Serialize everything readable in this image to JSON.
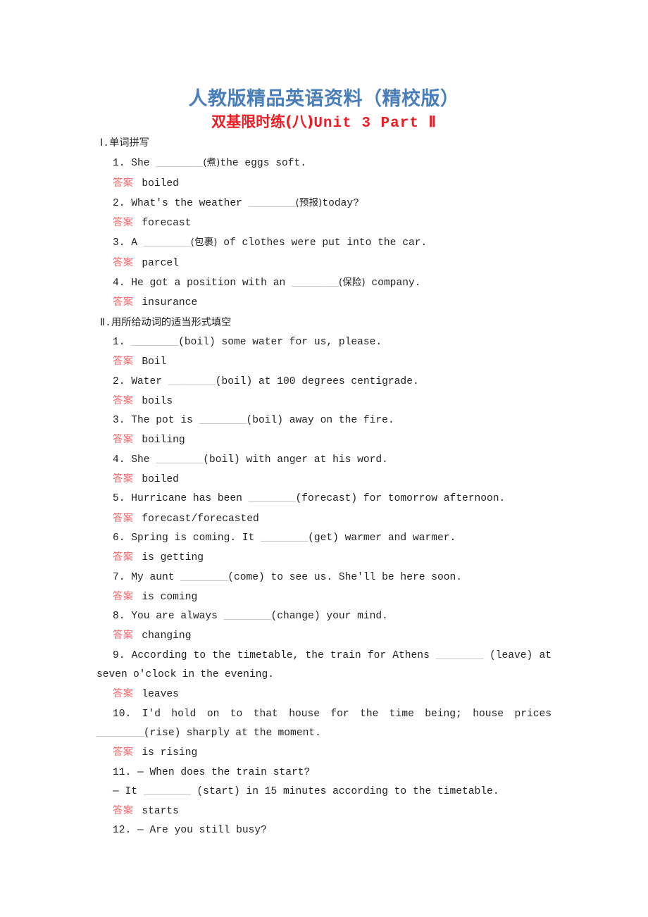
{
  "header": {
    "banner": "人教版精品英语资料（精校版）",
    "title_cn": "双基限时练(八)",
    "title_lat": "Unit 3  Part Ⅱ"
  },
  "answer_label": "答案",
  "blank": "________",
  "sections": [
    {
      "heading_num": "Ⅰ.",
      "heading_cn": "单词拼写",
      "items": [
        {
          "q_pre": "1. She ",
          "q_cn": "(煮)",
          "q_post": "the eggs soft.",
          "answer": "boiled"
        },
        {
          "q_pre": "2. What's the weather ",
          "q_cn": "(预报)",
          "q_post": "today?",
          "answer": "forecast"
        },
        {
          "q_pre": "3. A ",
          "q_cn": "(包裹)",
          "q_post": " of clothes were put into the car.",
          "answer": "parcel"
        },
        {
          "q_pre": "4. He got a position with an ",
          "q_cn": "(保险)",
          "q_post": " company.",
          "answer": "insurance"
        }
      ]
    },
    {
      "heading_num": "Ⅱ.",
      "heading_cn": "用所给动词的适当形式填空",
      "items": [
        {
          "q_pre": "1. ",
          "q_post": "(boil) some water for us, please.",
          "answer": "Boil"
        },
        {
          "q_pre": "2. Water ",
          "q_post": "(boil) at 100 degrees centigrade.",
          "answer": "boils"
        },
        {
          "q_pre": "3. The pot is ",
          "q_post": "(boil) away on the fire.",
          "answer": "boiling"
        },
        {
          "q_pre": "4. She ",
          "q_post": "(boil) with anger at his word.",
          "answer": "boiled"
        },
        {
          "q_pre": "5. Hurricane has been ",
          "q_post": "(forecast) for tomorrow afternoon.",
          "answer": "forecast/forecasted"
        },
        {
          "q_pre": "6. Spring is coming. It ",
          "q_post": "(get) warmer and warmer.",
          "answer": "is getting"
        },
        {
          "q_pre": "7. My aunt ",
          "q_post": "(come) to see us. She'll be here soon.",
          "answer": "is coming"
        },
        {
          "q_pre": "8. You are always ",
          "q_post": "(change) your mind.",
          "answer": "changing"
        },
        {
          "q_pre": "9. According to the timetable, the train for Athens ",
          "q_post": " (leave) at seven o'clock in the evening.",
          "answer": "leaves",
          "justify": true
        },
        {
          "q_pre": "10. I'd hold on to that house for the time being; house prices ",
          "q_post": "(rise) sharply at the moment.",
          "answer": "is rising",
          "justify": true
        },
        {
          "q_pre": "11. — When does the train start?",
          "q_post": "",
          "dash_line_pre": "— It ",
          "dash_line_post": " (start) in 15 minutes according to the timetable.",
          "answer": "starts"
        },
        {
          "q_pre": "12. — Are you still busy?",
          "q_post": "",
          "answer": null
        }
      ]
    }
  ]
}
